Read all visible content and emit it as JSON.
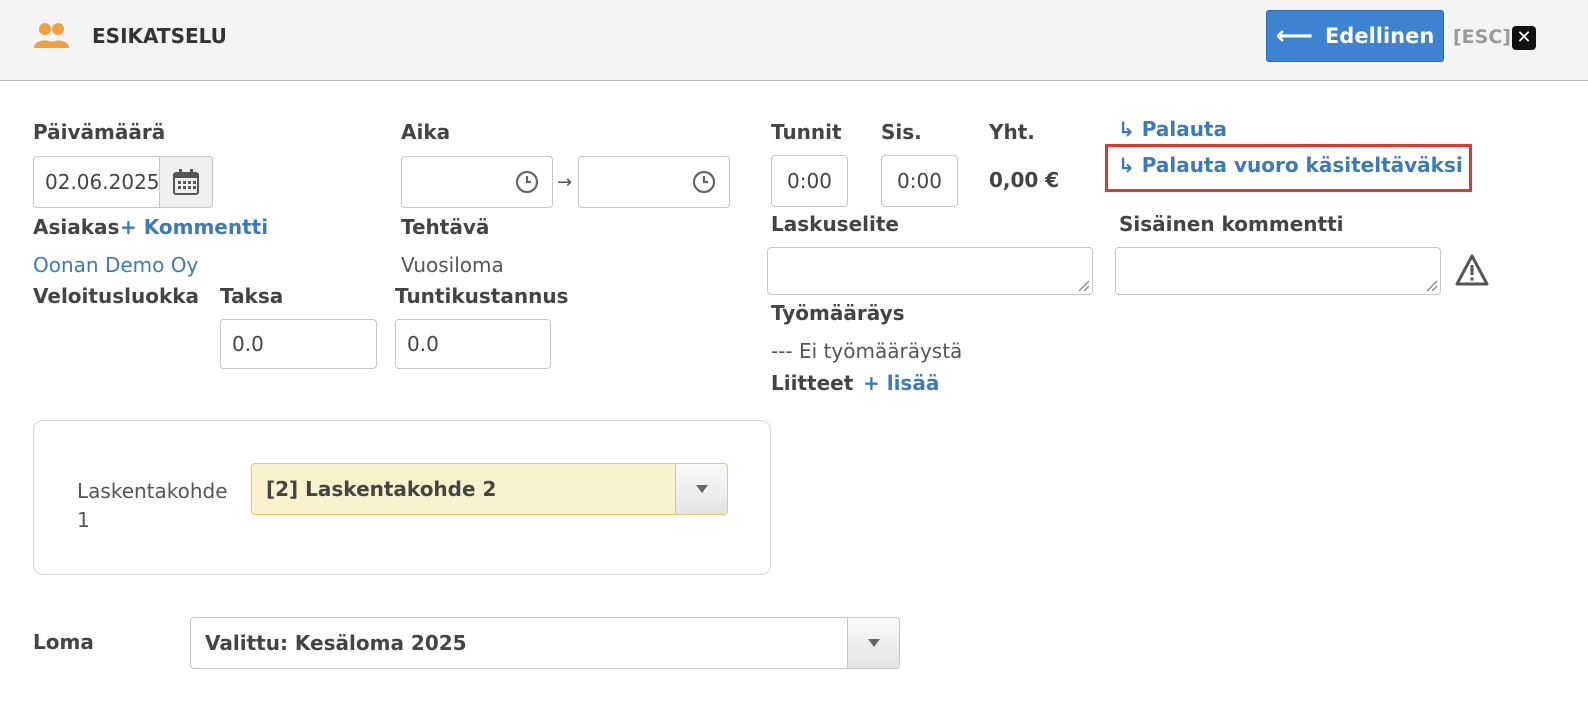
{
  "header": {
    "title": "ESIKATSELU",
    "back_label": "Edellinen",
    "esc_label": "[ESC]",
    "close_icon": "close-icon",
    "users_icon": "users-icon"
  },
  "date": {
    "label": "Päivämäärä",
    "value": "02.06.2025"
  },
  "time": {
    "label": "Aika",
    "start": "",
    "end": "",
    "arrow": "→"
  },
  "hours": {
    "tunnit_label": "Tunnit",
    "tunnit_value": "0:00",
    "sis_label": "Sis.",
    "sis_value": "0:00",
    "yht_label": "Yht.",
    "yht_value": "0,00 €"
  },
  "links": {
    "palauta": "↳ Palauta",
    "palauta_vuoro": "↳ Palauta vuoro käsiteltäväksi"
  },
  "asiakas": {
    "label": "Asiakas",
    "comment_link": "+ Kommentti",
    "value": "Oonan Demo Oy"
  },
  "tehtava": {
    "label": "Tehtävä",
    "value": "Vuosiloma"
  },
  "laskuselite": {
    "label": "Laskuselite",
    "value": ""
  },
  "sisainen": {
    "label": "Sisäinen kommentti",
    "value": ""
  },
  "veloitusluokka": {
    "label": "Veloitusluokka"
  },
  "taksa": {
    "label": "Taksa",
    "value": "0.0"
  },
  "tuntikustannus": {
    "label": "Tuntikustannus",
    "value": "0.0"
  },
  "tyomaarays": {
    "label": "Työmääräys",
    "value": "--- Ei työmääräystä"
  },
  "liitteet": {
    "label": "Liitteet",
    "add_link": "+ lisää"
  },
  "laskentakohde": {
    "label": "Laskentakohde 1",
    "selected": "[2] Laskentakohde 2",
    "bg": "#faf2cc"
  },
  "loma": {
    "label": "Loma",
    "selected": "Valittu: Kesäloma 2025"
  },
  "colors": {
    "accent": "#3d83d2",
    "link": "#3d7ab8",
    "highlight": "#e0392f"
  }
}
